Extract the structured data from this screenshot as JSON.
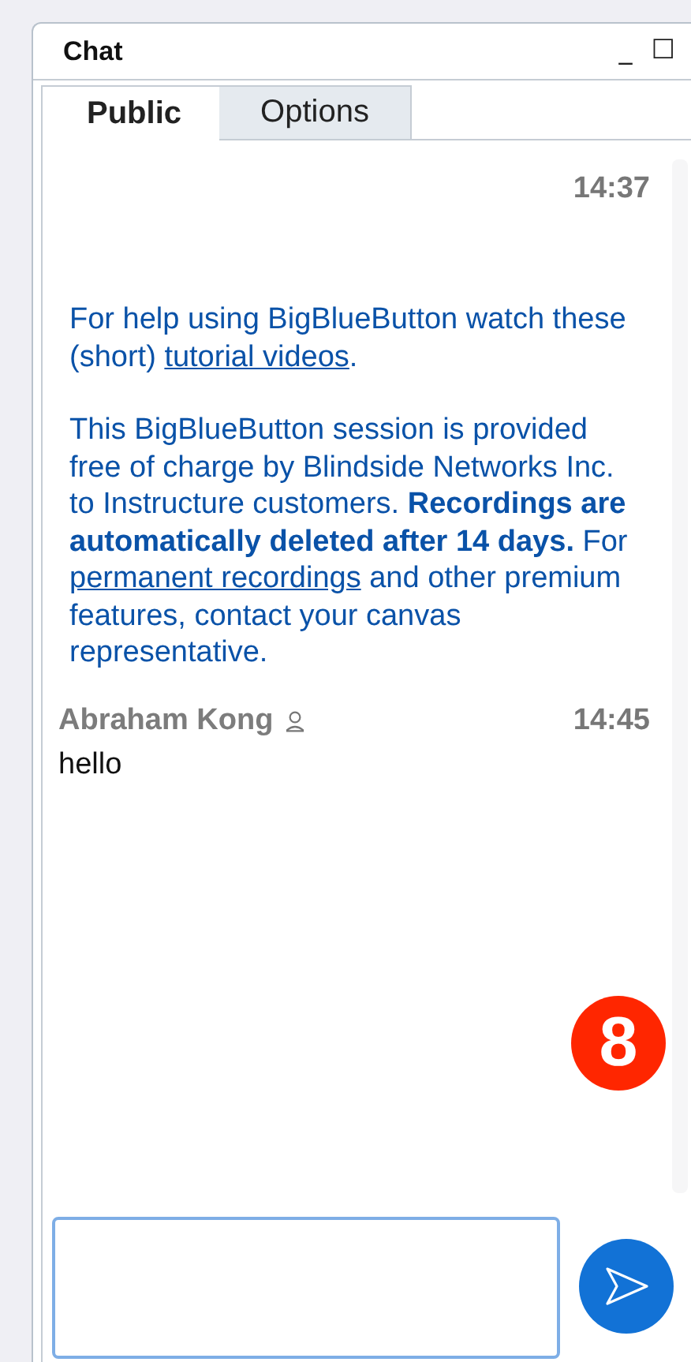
{
  "window": {
    "title": "Chat",
    "controls": [
      "_",
      "☐"
    ]
  },
  "tabs": [
    {
      "label": "Public",
      "selected": true
    },
    {
      "label": "Options",
      "selected": false
    }
  ],
  "messages": [
    {
      "kind": "system",
      "time": "14:37",
      "paragraphs": [
        [
          {
            "kind": "text",
            "text": "For help using BigBlueButton watch these (short) "
          },
          {
            "kind": "link",
            "text": "tutorial videos"
          },
          {
            "kind": "text",
            "text": "."
          }
        ],
        [
          {
            "kind": "text",
            "text": "This BigBlueButton session is provided free of charge by Blindside Networks Inc. to Instructure customers. **Recordings are automatically deleted after 14 days.**  For "
          },
          {
            "kind": "link",
            "text": "permanent recordings"
          },
          {
            "kind": "text",
            "text": " and other premium features, contact your canvas representative."
          }
        ]
      ]
    },
    {
      "kind": "user",
      "author": "Abraham Kong",
      "time": "14:45",
      "text": "hello"
    }
  ],
  "unread_badge": "8"
}
